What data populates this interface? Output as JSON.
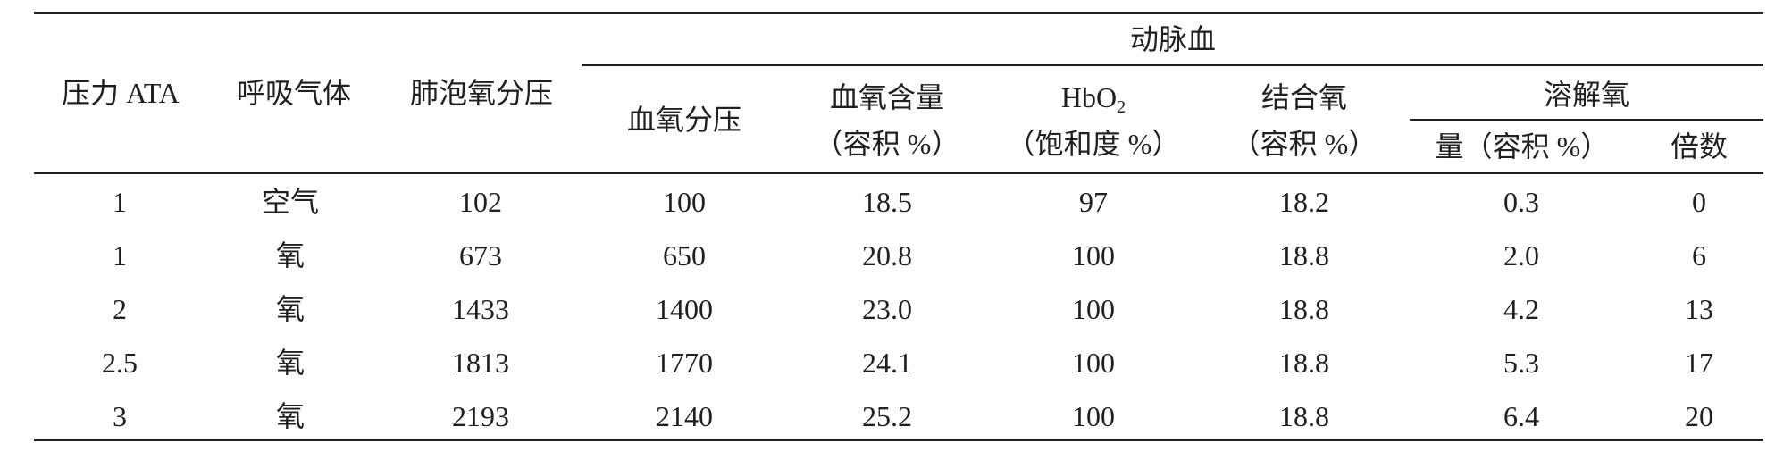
{
  "table": {
    "headers": {
      "pressure": "压力 ATA",
      "breathing_gas": "呼吸气体",
      "alveolar_po2": "肺泡氧分压",
      "arterial_blood": "动脉血",
      "blood_po2": "血氧分压",
      "blood_o2_content_line1": "血氧含量",
      "blood_o2_content_line2": "（容积 %）",
      "hbo2_base": "HbO",
      "hbo2_sub": "2",
      "hbo2_line2": "（饱和度 %）",
      "bound_o2_line1": "结合氧",
      "bound_o2_line2": "（容积 %）",
      "dissolved_o2": "溶解氧",
      "dissolved_amount": "量（容积 %）",
      "multiple": "倍数"
    },
    "rows": [
      [
        "1",
        "空气",
        "102",
        "100",
        "18.5",
        "97",
        "18.2",
        "0.3",
        "0"
      ],
      [
        "1",
        "氧",
        "673",
        "650",
        "20.8",
        "100",
        "18.8",
        "2.0",
        "6"
      ],
      [
        "2",
        "氧",
        "1433",
        "1400",
        "23.0",
        "100",
        "18.8",
        "4.2",
        "13"
      ],
      [
        "2.5",
        "氧",
        "1813",
        "1770",
        "24.1",
        "100",
        "18.8",
        "5.3",
        "17"
      ],
      [
        "3",
        "氧",
        "2193",
        "2140",
        "25.2",
        "100",
        "18.8",
        "6.4",
        "20"
      ]
    ]
  }
}
